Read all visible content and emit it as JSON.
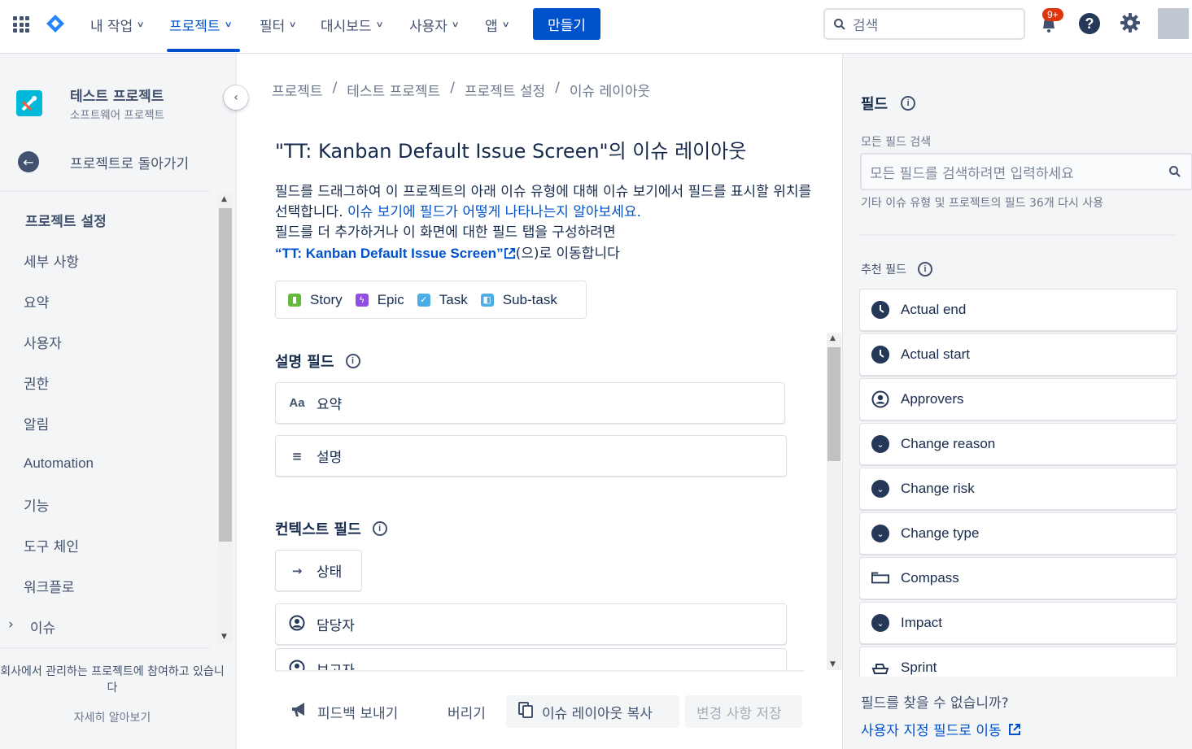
{
  "nav": {
    "items": [
      {
        "label": "내 작업"
      },
      {
        "label": "프로젝트"
      },
      {
        "label": "필터"
      },
      {
        "label": "대시보드"
      },
      {
        "label": "사용자"
      },
      {
        "label": "앱"
      }
    ],
    "create_label": "만들기",
    "search_placeholder": "검색",
    "notification_badge": "9+",
    "help_glyph": "?"
  },
  "sidebar": {
    "project_name": "테스트 프로젝트",
    "project_type": "소프트웨어 프로젝트",
    "back_label": "프로젝트로 돌아가기",
    "section_title": "프로젝트 설정",
    "items": [
      {
        "label": "세부 사항"
      },
      {
        "label": "요약"
      },
      {
        "label": "사용자"
      },
      {
        "label": "권한"
      },
      {
        "label": "알림"
      },
      {
        "label": "Automation"
      },
      {
        "label": "기능"
      },
      {
        "label": "도구 체인"
      },
      {
        "label": "워크플로"
      },
      {
        "label": "이슈"
      }
    ],
    "footer_text": "회사에서 관리하는 프로젝트에 참여하고 있습니다",
    "learn_more": "자세히 알아보기"
  },
  "breadcrumb": {
    "items": [
      "프로젝트",
      "테스트 프로젝트",
      "프로젝트 설정",
      "이슈 레이아웃"
    ],
    "separator": "/"
  },
  "main": {
    "title": "\"TT: Kanban Default Issue Screen\"의 이슈 레이아웃",
    "desc_line1": "필드를 드래그하여 이 프로젝트의 아래 이슈 유형에 대해 이슈 보기에서 필드를 표시할 위치를 선택합니다. ",
    "desc_link": "이슈 보기에 필드가 어떻게 나타나는지 알아보세요.",
    "desc_line2": "필드를 더 추가하거나 이 화면에 대한 필드 탭을 구성하려면",
    "desc_screen_link": "“TT: Kanban Default Issue Screen”",
    "desc_tail": "(으)로 이동합니다",
    "issue_types": [
      {
        "label": "Story",
        "color": "#63ba3c"
      },
      {
        "label": "Epic",
        "color": "#904ee2"
      },
      {
        "label": "Task",
        "color": "#4bade8"
      },
      {
        "label": "Sub-task",
        "color": "#4bade8"
      }
    ],
    "description_section": "설명 필드",
    "description_fields": [
      {
        "label": "요약",
        "icon": "Aa"
      },
      {
        "label": "설명",
        "icon": "≡"
      }
    ],
    "context_section": "컨텍스트 필드",
    "context_fields": [
      {
        "label": "상태",
        "icon": "→"
      },
      {
        "label": "담당자",
        "icon": "person"
      },
      {
        "label": "보고자",
        "icon": "person"
      }
    ],
    "footer": {
      "feedback": "피드백 보내기",
      "discard": "버리기",
      "copy": "이슈 레이아웃 복사",
      "save": "변경 사항 저장"
    }
  },
  "right_panel": {
    "title": "필드",
    "search_label": "모든 필드 검색",
    "search_placeholder": "모든 필드를 검색하려면 입력하세요",
    "hint": "기타 이슈 유형 및 프로젝트의 필드 36개 다시 사용",
    "recommended_title": "추천 필드",
    "fields": [
      {
        "label": "Actual end",
        "icon": "clock-icon"
      },
      {
        "label": "Actual start",
        "icon": "clock-icon"
      },
      {
        "label": "Approvers",
        "icon": "person-icon"
      },
      {
        "label": "Change reason",
        "icon": "chevron-down-icon"
      },
      {
        "label": "Change risk",
        "icon": "chevron-down-icon"
      },
      {
        "label": "Change type",
        "icon": "chevron-down-icon"
      },
      {
        "label": "Compass",
        "icon": "component-icon"
      },
      {
        "label": "Impact",
        "icon": "chevron-down-icon"
      },
      {
        "label": "Sprint",
        "icon": "sprint-icon"
      }
    ],
    "cant_find": "필드를 찾을 수 없습니까?",
    "custom_link": "사용자 지정 필드로 이동"
  },
  "colors": {
    "primary": "#0052cc",
    "text": "#172b4d",
    "subtle": "#6b778c",
    "badge": "#de350b"
  }
}
